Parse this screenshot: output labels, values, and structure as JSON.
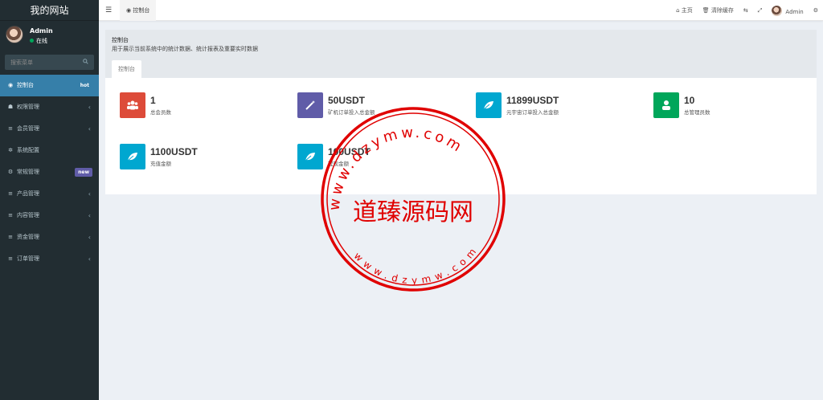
{
  "app": {
    "title": "我的网站"
  },
  "user": {
    "name": "Admin",
    "status": "在线"
  },
  "search": {
    "placeholder": "搜索菜单"
  },
  "sidebar": {
    "items": [
      {
        "label": "控制台",
        "icon": "dashboard-icon",
        "badge": "hot",
        "active": true
      },
      {
        "label": "权限管理",
        "icon": "users-icon",
        "arrow": "‹"
      },
      {
        "label": "会员管理",
        "icon": "list-icon",
        "arrow": "‹"
      },
      {
        "label": "系统配置",
        "icon": "gear-icon"
      },
      {
        "label": "常规管理",
        "icon": "cogs-icon",
        "badge": "new"
      },
      {
        "label": "产品管理",
        "icon": "list-icon",
        "arrow": "‹"
      },
      {
        "label": "内容管理",
        "icon": "list-icon",
        "arrow": "‹"
      },
      {
        "label": "资金管理",
        "icon": "list-icon",
        "arrow": "‹"
      },
      {
        "label": "订单管理",
        "icon": "list-icon",
        "arrow": "‹"
      }
    ]
  },
  "topbar": {
    "tab_label": "控制台",
    "home_label": "主页",
    "clear_cache_label": "清除缓存",
    "user_label": "Admin"
  },
  "header": {
    "title": "控制台",
    "description": "用于展示当前系统中的统计数据、统计报表及重要实时数据",
    "tab_label": "控制台"
  },
  "stats": [
    {
      "value": "1",
      "label": "总会员数",
      "color": "#dd4b39",
      "icon": "users-icon"
    },
    {
      "value": "50USDT",
      "label": "矿机订单投入总金额",
      "color": "#605ca8",
      "icon": "magic-wand-icon"
    },
    {
      "value": "11899USDT",
      "label": "元宇宙订单投入总金额",
      "color": "#00a7d0",
      "icon": "leaf-icon"
    },
    {
      "value": "10",
      "label": "总管理员数",
      "color": "#00a65a",
      "icon": "user-icon"
    },
    {
      "value": "1100USDT",
      "label": "充值金额",
      "color": "#00a7d0",
      "icon": "leaf-icon"
    },
    {
      "value": "100USDT",
      "label": "提现金额",
      "color": "#00a7d0",
      "icon": "leaf-icon"
    }
  ],
  "watermark": {
    "center_text": "道臻源码网",
    "ring_text": "www.dzymw.com"
  },
  "colors": {
    "sidebar_bg": "#222d32",
    "accent": "#3c8dbc",
    "stamp": "#e00000"
  }
}
